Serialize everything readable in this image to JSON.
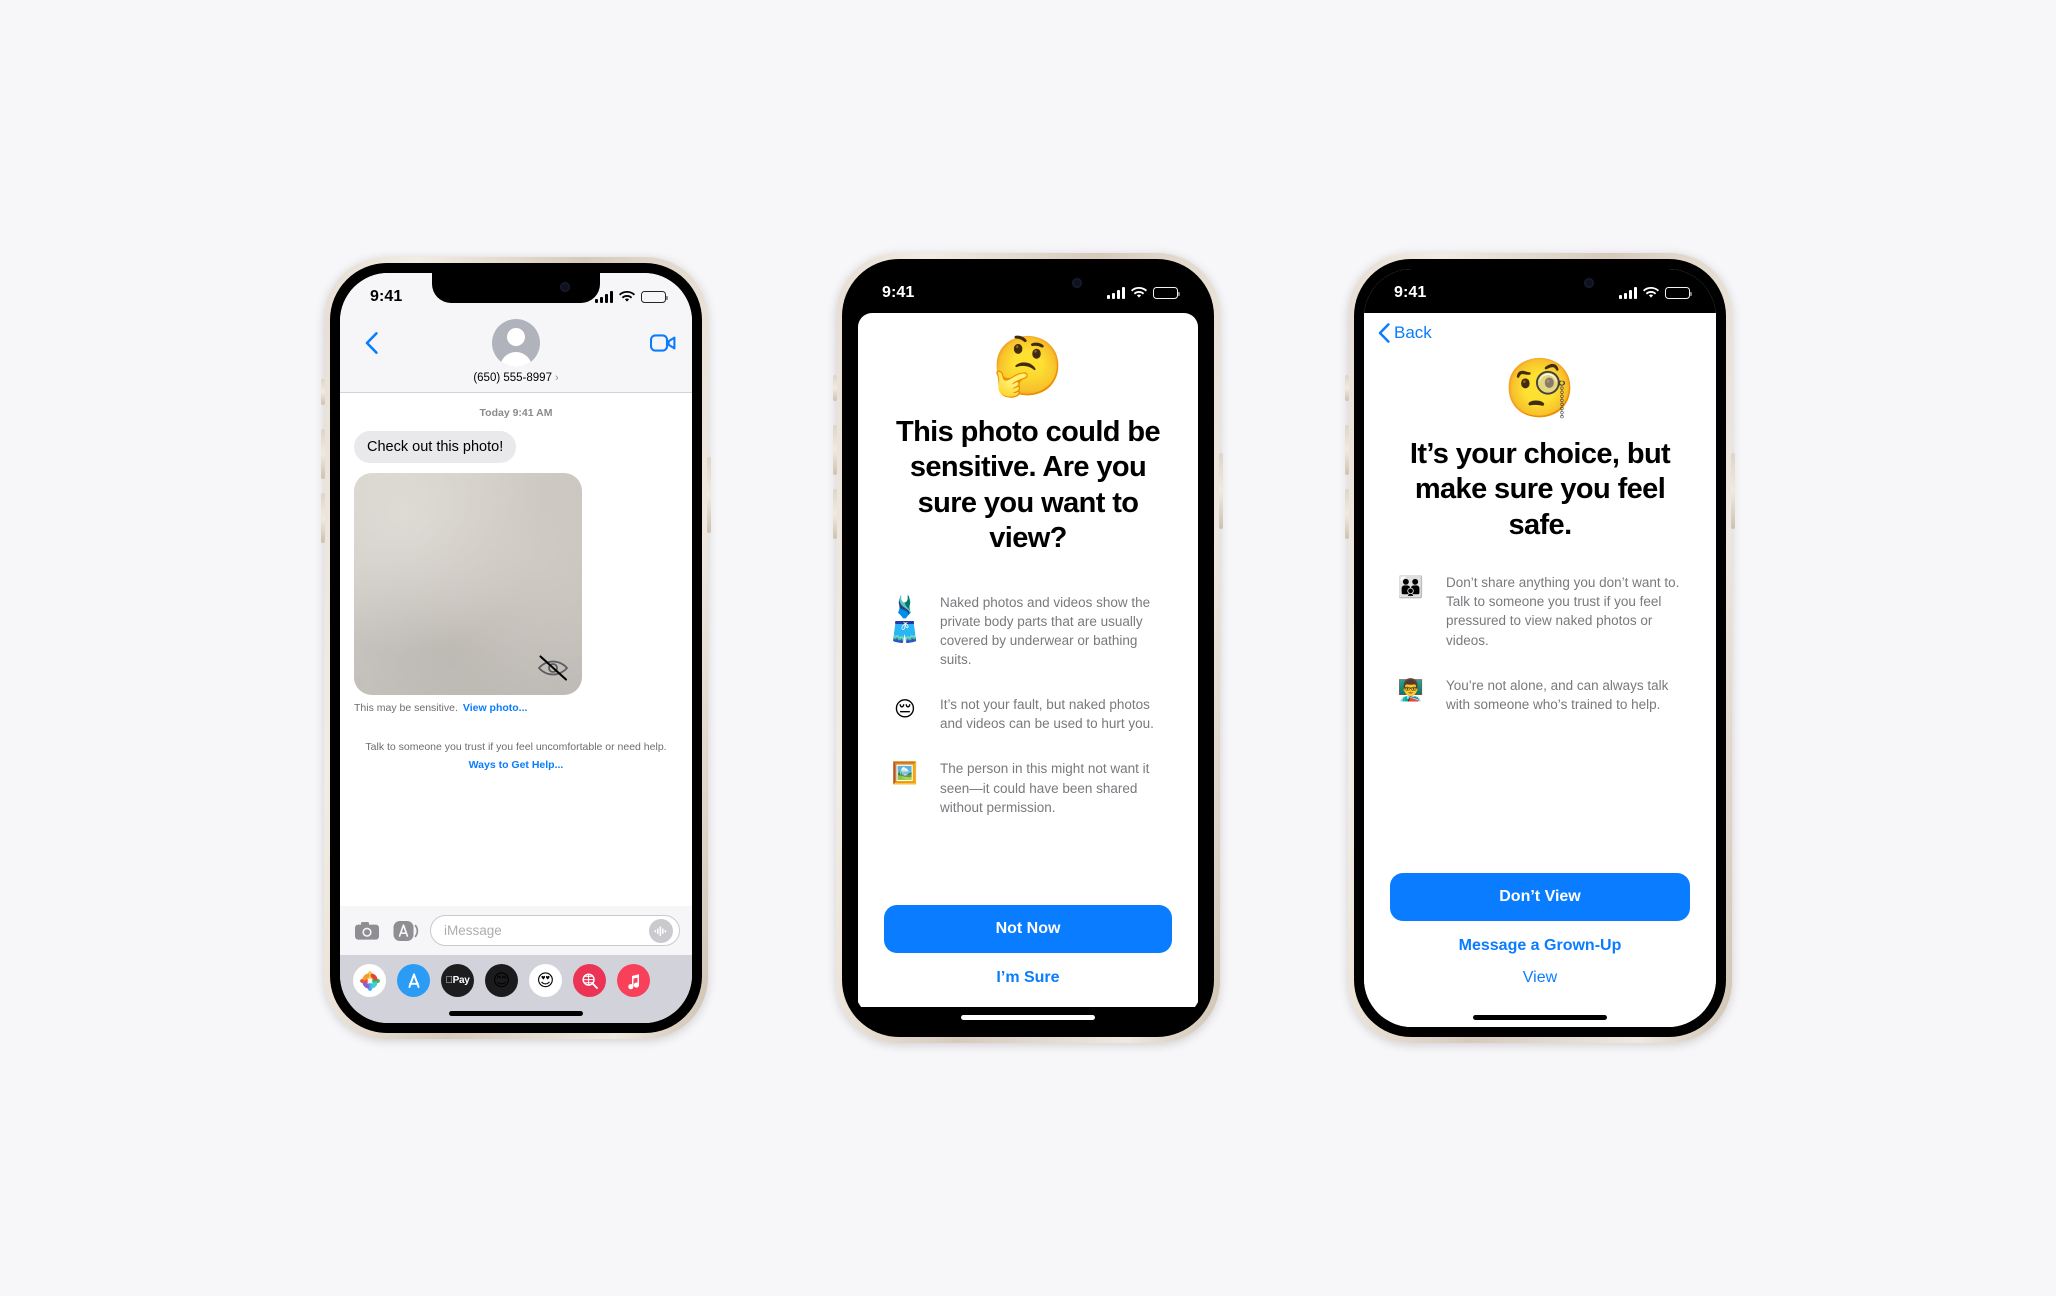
{
  "page": {
    "background_color": "#f7f7f9",
    "accent_color": "#0a7cff"
  },
  "phone1": {
    "status": {
      "time": "9:41",
      "signal_icon": "cellular-bars-icon",
      "wifi_icon": "wifi-icon",
      "battery_icon": "battery-icon"
    },
    "header": {
      "back_icon": "chevron-left-icon",
      "avatar_icon": "contact-avatar-placeholder",
      "contact_name": "(650) 555-8997",
      "disclosure_glyph": "›",
      "facetime_icon": "video-camera-icon"
    },
    "thread": {
      "daystamp": "Today 9:41 AM",
      "message_text": "Check out this photo!",
      "photo_state_icon": "eye-slash-icon",
      "sensitive_label": "This may be sensitive.",
      "view_photo_link": "View photo...",
      "help_text": "Talk to someone you trust if you feel uncomfortable or need help.",
      "help_link": "Ways to Get Help..."
    },
    "compose": {
      "camera_icon": "camera-icon",
      "appstore_icon": "imessage-apps-icon",
      "placeholder": "iMessage",
      "audio_icon": "audio-waveform-icon"
    },
    "app_drawer": [
      {
        "name": "photos-app-icon",
        "glyph": "✿"
      },
      {
        "name": "app-store-app-icon",
        "glyph": "A"
      },
      {
        "name": "apple-pay-app-icon",
        "glyph": "Pay"
      },
      {
        "name": "memoji-sticker-icon",
        "glyph": "🙂"
      },
      {
        "name": "memoji-heart-eyes-icon",
        "glyph": "😍"
      },
      {
        "name": "images-search-app-icon",
        "glyph": "🔍"
      },
      {
        "name": "music-app-icon",
        "glyph": "♪"
      }
    ]
  },
  "phone2": {
    "status": {
      "time": "9:41",
      "signal_icon": "cellular-bars-icon",
      "wifi_icon": "wifi-icon",
      "battery_icon": "battery-icon"
    },
    "hero_emoji": "🤔",
    "hero_emoji_name": "thinking-face-emoji",
    "title": "This photo could be sensitive. Are you sure you want to view?",
    "bullets": [
      {
        "emoji": "🩱🩳",
        "emoji_name": "swimwear-emoji",
        "text": "Naked photos and videos show the private body parts that are usually covered by underwear or bathing suits."
      },
      {
        "emoji": "😔",
        "emoji_name": "pensive-face-emoji",
        "text": "It’s not your fault, but naked photos and videos can be used to hurt you."
      },
      {
        "emoji": "🖼️",
        "emoji_name": "framed-picture-emoji",
        "text": "The person in this might not want it seen—it could have been shared without permission."
      }
    ],
    "primary_button": "Not Now",
    "secondary_link": "I’m Sure"
  },
  "phone3": {
    "status": {
      "time": "9:41",
      "signal_icon": "cellular-bars-icon",
      "wifi_icon": "wifi-icon",
      "battery_icon": "battery-icon"
    },
    "back_label": "Back",
    "back_icon": "chevron-left-icon",
    "hero_emoji": "🧐",
    "hero_emoji_name": "monocle-face-emoji",
    "title": "It’s your choice, but make sure you feel safe.",
    "bullets": [
      {
        "emoji": "👪",
        "emoji_name": "family-emoji",
        "text": "Don’t share anything you don’t want to. Talk to someone you trust if you feel pressured to view naked photos or videos."
      },
      {
        "emoji": "👨‍🏫",
        "emoji_name": "teacher-emoji",
        "text": "You’re not alone, and can always talk with someone who’s trained to help."
      }
    ],
    "primary_button": "Don’t View",
    "secondary_link": "Message a Grown-Up",
    "tertiary_link": "View"
  }
}
